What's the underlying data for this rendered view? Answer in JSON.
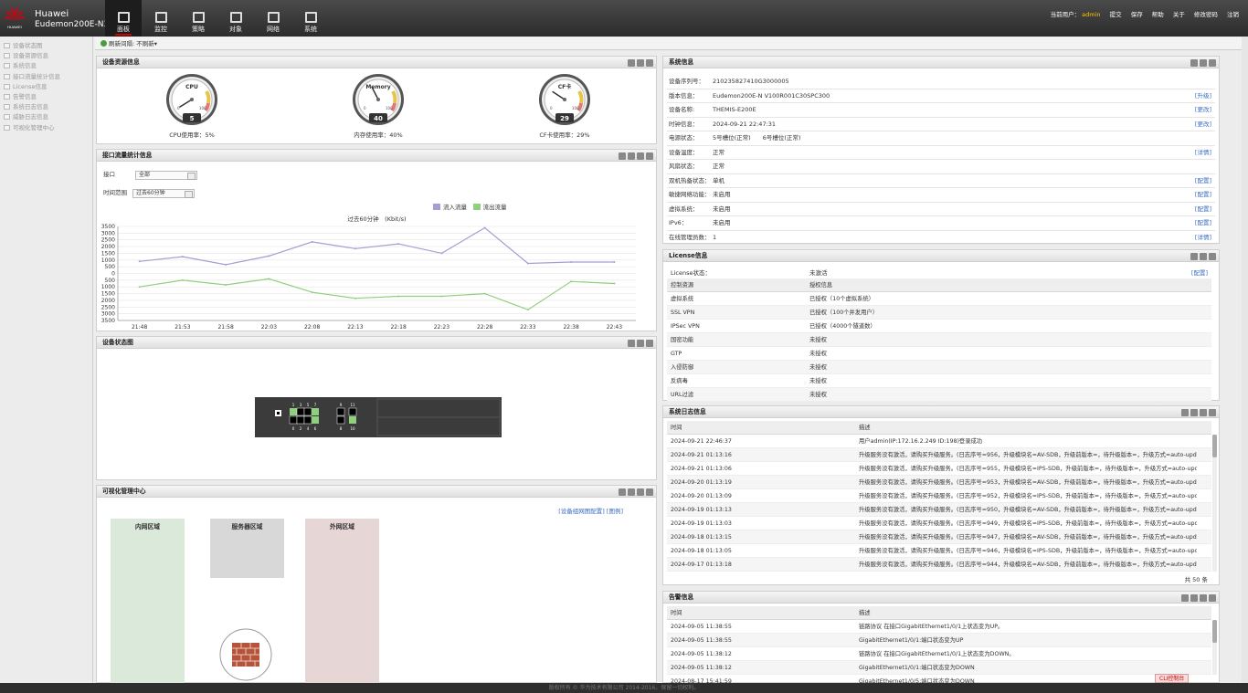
{
  "header": {
    "brand": "Huawei",
    "model": "Eudemon200E-N3",
    "logo_text": "HUAWEI",
    "nav": [
      {
        "label": "面板",
        "icon": "panel-icon"
      },
      {
        "label": "监控",
        "icon": "monitor-icon"
      },
      {
        "label": "策略",
        "icon": "policy-icon"
      },
      {
        "label": "对象",
        "icon": "object-icon"
      },
      {
        "label": "网络",
        "icon": "network-icon"
      },
      {
        "label": "系统",
        "icon": "system-icon"
      }
    ],
    "current_user_label": "当前用户：",
    "user": "admin",
    "links": [
      "提交",
      "保存",
      "帮助",
      "关于",
      "修改密码",
      "注销"
    ]
  },
  "sidebar": {
    "items": [
      "设备状态图",
      "设备资源信息",
      "系统信息",
      "接口流量统计信息",
      "License信息",
      "告警信息",
      "系统日志信息",
      "威胁日志信息",
      "可视化管理中心"
    ]
  },
  "refresh": {
    "label": "刷新间隔:",
    "value": "不刷新"
  },
  "resource": {
    "title": "设备资源信息",
    "gauges": [
      {
        "name": "CPU",
        "value": "5",
        "label": "CPU使用率：5%",
        "level": 5
      },
      {
        "name": "Memory",
        "value": "40",
        "label": "内存使用率：40%",
        "level": 40
      },
      {
        "name": "CF卡",
        "value": "29",
        "label": "CF卡使用率：29%",
        "level": 29
      }
    ],
    "scale": [
      "0",
      "100"
    ]
  },
  "traffic": {
    "title": "接口流量统计信息",
    "iface_label": "接口",
    "iface_value": "全部",
    "time_label": "时间范围",
    "time_value": "过去60分钟",
    "legend_in": "流入流量",
    "legend_out": "流出流量",
    "chart_title": "过去60分钟　(Kbit/s)"
  },
  "chart_data": {
    "type": "line",
    "title": "过去60分钟　(Kbit/s)",
    "x": [
      "21:48",
      "21:53",
      "21:58",
      "22:03",
      "22:08",
      "22:13",
      "22:18",
      "22:23",
      "22:28",
      "22:33",
      "22:38",
      "22:43"
    ],
    "ylim": [
      -3500,
      3500
    ],
    "yticks": [
      "3500",
      "3000",
      "2500",
      "2000",
      "1500",
      "1000",
      "500",
      "0",
      "500",
      "1000",
      "1500",
      "2000",
      "2500",
      "3000",
      "3500"
    ],
    "series": [
      {
        "name": "流入流量",
        "color": "#a99cd2",
        "values": [
          900,
          1250,
          650,
          1300,
          2350,
          1850,
          2200,
          1500,
          3400,
          750,
          850,
          850
        ]
      },
      {
        "name": "流出流量",
        "color": "#8fd07e",
        "values": [
          -1000,
          -500,
          -850,
          -400,
          -1400,
          -1850,
          -1700,
          -1700,
          -1500,
          -2700,
          -600,
          -750
        ]
      }
    ]
  },
  "device_status": {
    "title": "设备状态图",
    "ports_top": [
      "1",
      "3",
      "5",
      "7"
    ],
    "ports_bottom": [
      "0",
      "2",
      "4",
      "6"
    ],
    "ports_top2": [
      "9",
      "11"
    ],
    "ports_bottom2": [
      "8",
      "10"
    ]
  },
  "visual": {
    "title": "可视化管理中心",
    "links": [
      "[设备组网图配置]",
      "[图例]"
    ],
    "zones": [
      "内网区域",
      "服务器区域",
      "外网区域"
    ]
  },
  "sysinfo": {
    "title": "系统信息",
    "rows": [
      {
        "k": "设备序列号：",
        "v": "210235827410G3000005",
        "a": ""
      },
      {
        "k": "版本信息：",
        "v": "Eudemon200E-N V100R001C30SPC300",
        "a": "[升级]"
      },
      {
        "k": "设备名称:",
        "v": "THEMIS-E200E",
        "a": "[更改]"
      },
      {
        "k": "时钟信息：",
        "v": "2024-09-21 22:47:31",
        "a": "[更改]"
      },
      {
        "k": "电源状态：",
        "v": "5号槽位(正常)　　6号槽位(正常)",
        "a": ""
      },
      {
        "k": "设备温度：",
        "v": "正常",
        "a": "[详情]"
      },
      {
        "k": "风扇状态：",
        "v": "正常",
        "a": ""
      },
      {
        "k": "双机热备状态：",
        "v": "单机",
        "a": "[配置]"
      },
      {
        "k": "敏捷网络功能：",
        "v": "未启用",
        "a": "[配置]"
      },
      {
        "k": "虚拟系统：",
        "v": "未启用",
        "a": "[配置]"
      },
      {
        "k": "IPv6：",
        "v": "未启用",
        "a": "[配置]"
      },
      {
        "k": "在线管理员数：",
        "v": "1",
        "a": "[详情]"
      }
    ]
  },
  "license": {
    "title": "License信息",
    "status_label": "License状态：",
    "status": "未激活",
    "action": "[配置]",
    "headers": [
      "控制资源",
      "授权信息"
    ],
    "rows": [
      [
        "虚拟系统",
        "已授权（10个虚拟系统）"
      ],
      [
        "SSL VPN",
        "已授权（100个并发用户）"
      ],
      [
        "IPSec VPN",
        "已授权（4000个隧道数）"
      ],
      [
        "国密功能",
        "未授权"
      ],
      [
        "GTP",
        "未授权"
      ],
      [
        "入侵防御",
        "未授权"
      ],
      [
        "反病毒",
        "未授权"
      ],
      [
        "URL过滤",
        "未授权"
      ]
    ]
  },
  "syslog": {
    "title": "系统日志信息",
    "headers": [
      "时间",
      "描述"
    ],
    "total": "共 50 条",
    "rows": [
      [
        "2024-09-21 22:46:37",
        "用户admin(IP:172.16.2.249 ID:198)登录成功"
      ],
      [
        "2024-09-21 01:13:16",
        "升级服务没有激活，请购买升级服务。(日志序号=956，升级模块名=AV-SDB，升级前版本=，待升级版本=，升级方式=auto-upd..."
      ],
      [
        "2024-09-21 01:13:06",
        "升级服务没有激活，请购买升级服务。(日志序号=955，升级模块名=IPS-SDB，升级前版本=，待升级版本=，升级方式=auto-upd..."
      ],
      [
        "2024-09-20 01:13:19",
        "升级服务没有激活，请购买升级服务。(日志序号=953，升级模块名=AV-SDB，升级前版本=，待升级版本=，升级方式=auto-upd..."
      ],
      [
        "2024-09-20 01:13:09",
        "升级服务没有激活，请购买升级服务。(日志序号=952，升级模块名=IPS-SDB，升级前版本=，待升级版本=，升级方式=auto-upd..."
      ],
      [
        "2024-09-19 01:13:13",
        "升级服务没有激活，请购买升级服务。(日志序号=950，升级模块名=AV-SDB，升级前版本=，待升级版本=，升级方式=auto-upd..."
      ],
      [
        "2024-09-19 01:13:03",
        "升级服务没有激活，请购买升级服务。(日志序号=949，升级模块名=IPS-SDB，升级前版本=，待升级版本=，升级方式=auto-upd..."
      ],
      [
        "2024-09-18 01:13:15",
        "升级服务没有激活，请购买升级服务。(日志序号=947，升级模块名=AV-SDB，升级前版本=，待升级版本=，升级方式=auto-upd..."
      ],
      [
        "2024-09-18 01:13:05",
        "升级服务没有激活，请购买升级服务。(日志序号=946，升级模块名=IPS-SDB，升级前版本=，待升级版本=，升级方式=auto-upd..."
      ],
      [
        "2024-09-17 01:13:18",
        "升级服务没有激活，请购买升级服务。(日志序号=944，升级模块名=AV-SDB，升级前版本=，待升级版本=，升级方式=auto-upd..."
      ]
    ]
  },
  "alarm": {
    "title": "告警信息",
    "headers": [
      "时间",
      "描述"
    ],
    "cli": "CLI控制台",
    "rows": [
      [
        "2024-09-05 11:38:55",
        "链路协议 在接口GigabitEthernet1/0/1上状态变为UP。"
      ],
      [
        "2024-09-05 11:38:55",
        "GigabitEthernet1/0/1:端口状态变为UP"
      ],
      [
        "2024-09-05 11:38:12",
        "链路协议 在接口GigabitEthernet1/0/1上状态变为DOWN。"
      ],
      [
        "2024-09-05 11:38:12",
        "GigabitEthernet1/0/1:端口状态变为DOWN"
      ],
      [
        "2024-08-17 15:41:59",
        "GigabitEthernet1/0/5:端口状态变为DOWN"
      ]
    ]
  },
  "footer": "版权所有 © 华为技术有限公司 2014-2016。保留一切权利。"
}
